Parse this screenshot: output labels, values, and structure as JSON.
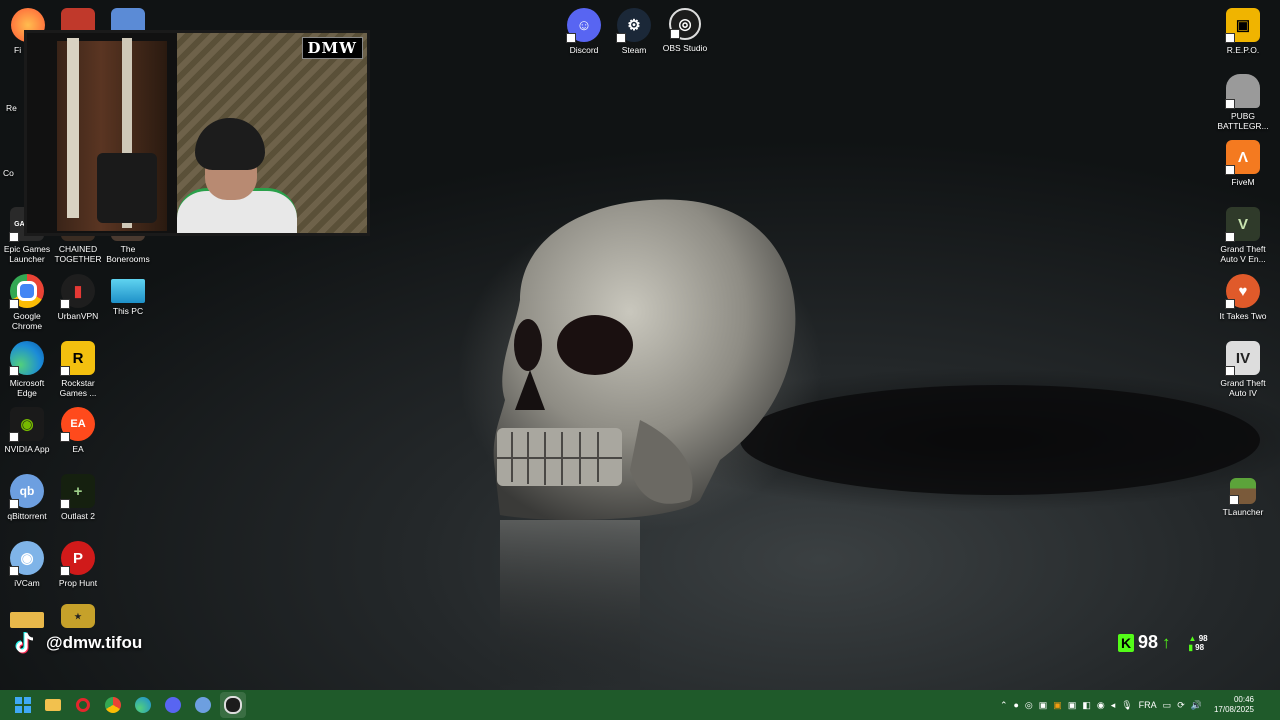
{
  "desktop": {
    "icons_left": [
      {
        "label": "Epic Games Launcher",
        "icon": "epic-games-icon"
      },
      {
        "label": "CHAINED TOGETHER",
        "icon": "chained-together-icon"
      },
      {
        "label": "The Bonerooms",
        "icon": "bonerooms-icon"
      },
      {
        "label": "Google Chrome",
        "icon": "chrome-icon"
      },
      {
        "label": "UrbanVPN",
        "icon": "urbanvpn-icon"
      },
      {
        "label": "This PC",
        "icon": "this-pc-icon"
      },
      {
        "label": "Microsoft Edge",
        "icon": "edge-icon"
      },
      {
        "label": "Rockstar Games ...",
        "icon": "rockstar-icon"
      },
      {
        "label": "NVIDIA App",
        "icon": "nvidia-icon"
      },
      {
        "label": "EA",
        "icon": "ea-icon"
      },
      {
        "label": "qBittorrent",
        "icon": "qbittorrent-icon"
      },
      {
        "label": "Outlast 2",
        "icon": "outlast-icon"
      },
      {
        "label": "iVCam",
        "icon": "ivcam-icon"
      },
      {
        "label": "Prop Hunt",
        "icon": "prophunt-icon"
      }
    ],
    "icons_top": [
      {
        "label": "Discord",
        "icon": "discord-icon"
      },
      {
        "label": "Steam",
        "icon": "steam-icon"
      },
      {
        "label": "OBS Studio",
        "icon": "obs-icon"
      }
    ],
    "icons_right": [
      {
        "label": "R.E.P.O.",
        "icon": "repo-icon"
      },
      {
        "label": "PUBG BATTLEGR...",
        "icon": "pubg-icon"
      },
      {
        "label": "FiveM",
        "icon": "fivem-icon"
      },
      {
        "label": "Grand Theft Auto V En...",
        "icon": "gta5-icon"
      },
      {
        "label": "It Takes Two",
        "icon": "ittakestwo-icon"
      },
      {
        "label": "Grand Theft Auto IV",
        "icon": "gta4-icon"
      },
      {
        "label": "TLauncher",
        "icon": "tlauncher-icon"
      }
    ],
    "partial_labels": [
      "Fi",
      "Re",
      "Co"
    ]
  },
  "webcam": {
    "watermark": "DMW"
  },
  "overlay": {
    "tiktok_handle": "@dmw.tifou",
    "kick_viewers": "98",
    "kick_small_top": "98",
    "kick_small_bottom": "98"
  },
  "taskbar": {
    "lang": "FRA",
    "time": "00:46",
    "date": "17/08/2025",
    "colors": {
      "bg": "#1f5a2a"
    }
  }
}
